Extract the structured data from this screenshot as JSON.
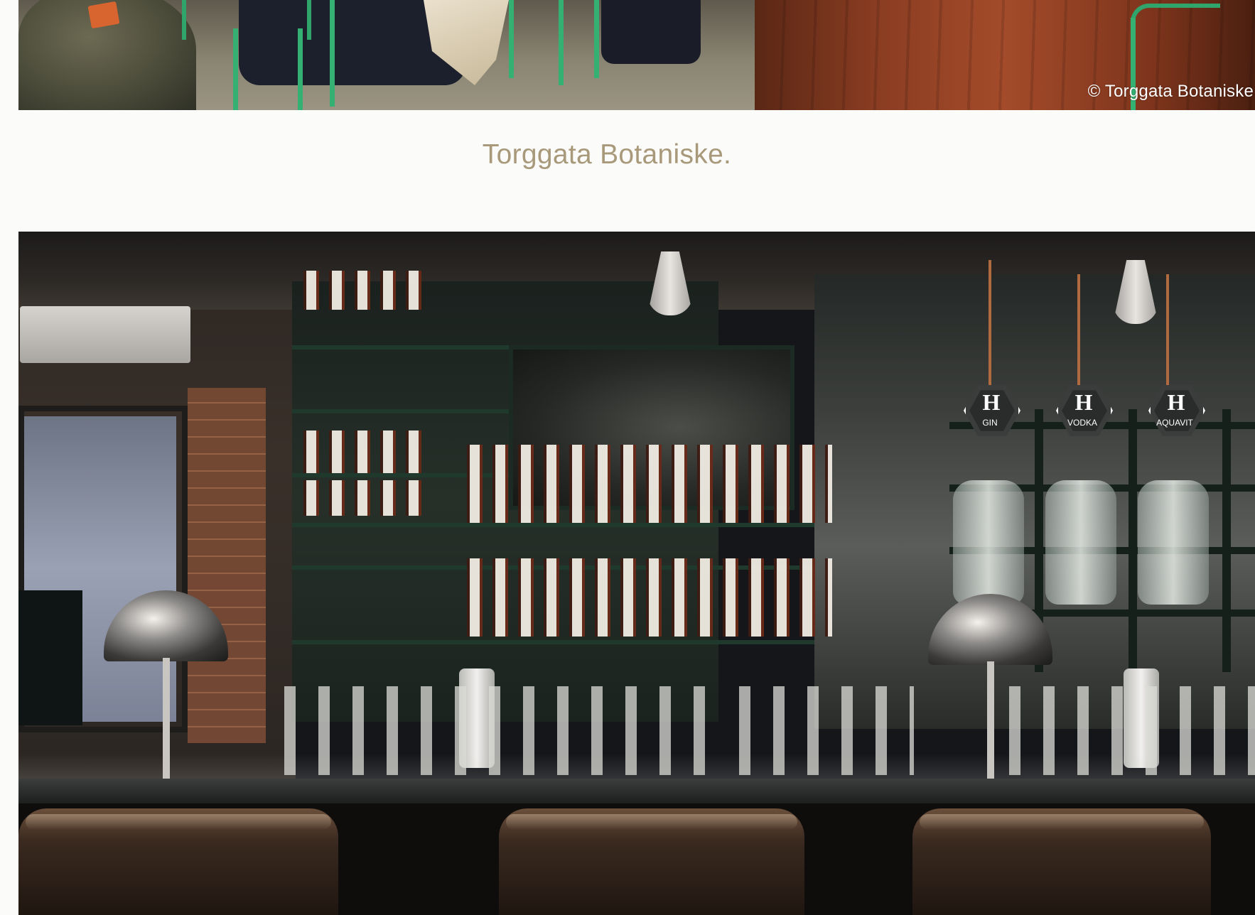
{
  "top_photo": {
    "copyright": "©  Torggata Botaniske"
  },
  "caption": {
    "text": "Torggata Botaniske."
  },
  "bar_photo": {
    "signs": [
      "GIN",
      "VODKA",
      "AQUAVIT"
    ]
  }
}
